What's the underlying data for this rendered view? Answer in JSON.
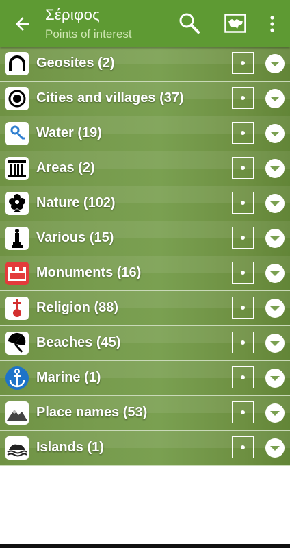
{
  "appbar": {
    "title": "Σέριφος",
    "subtitle": "Points of interest",
    "back_icon": "arrow-back-icon",
    "search_icon": "search-icon",
    "map_icon": "map-icon",
    "menu_icon": "more-vert-icon"
  },
  "categories": [
    {
      "label": "Geosites (2)",
      "icon": "geosite-arch-icon"
    },
    {
      "label": "Cities and villages (37)",
      "icon": "city-target-icon"
    },
    {
      "label": "Water (19)",
      "icon": "water-drop-icon"
    },
    {
      "label": "Areas (2)",
      "icon": "column-icon"
    },
    {
      "label": "Nature (102)",
      "icon": "flower-icon"
    },
    {
      "label": "Various (15)",
      "icon": "monument-figure-icon"
    },
    {
      "label": "Monuments (16)",
      "icon": "castle-icon"
    },
    {
      "label": "Religion (88)",
      "icon": "cross-icon"
    },
    {
      "label": "Beaches (45)",
      "icon": "umbrella-icon"
    },
    {
      "label": "Marine (1)",
      "icon": "anchor-icon"
    },
    {
      "label": "Place names (53)",
      "icon": "mountain-icon"
    },
    {
      "label": "Islands (1)",
      "icon": "island-icon"
    }
  ],
  "colors": {
    "appbar": "#5e9a33",
    "row": "#779b4d",
    "subtitle": "#cfe6b3"
  }
}
